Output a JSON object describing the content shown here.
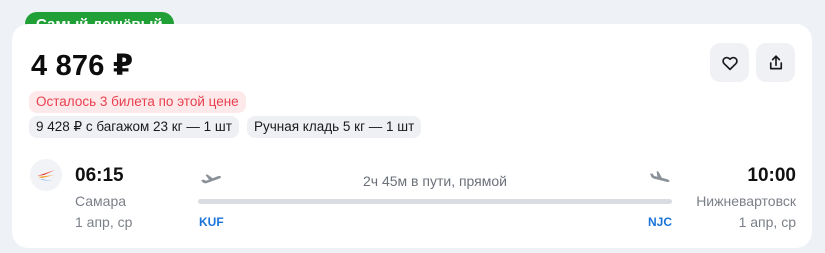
{
  "badge": {
    "label": "Самый дешёвый",
    "color": "#21a038"
  },
  "price": "4 876 ₽",
  "actions": {
    "favorite_icon": "heart-icon",
    "share_icon": "share-icon"
  },
  "warning": "Осталось 3 билета по этой цене",
  "options": {
    "baggage": "9 428 ₽ с багажом 23 кг — 1 шт",
    "hand_luggage": "Ручная кладь 5 кг — 1 шт"
  },
  "flight": {
    "departure": {
      "time": "06:15",
      "city": "Самара",
      "date": "1 апр, ср",
      "iata": "KUF"
    },
    "arrival": {
      "time": "10:00",
      "city": "Нижневартовск",
      "date": "1 апр, ср",
      "iata": "NJC"
    },
    "duration": "2ч 45м в пути, прямой"
  },
  "colors": {
    "accent": "#1a73d9",
    "warning_text": "#e8404e",
    "warning_bg": "#fde8ea"
  }
}
